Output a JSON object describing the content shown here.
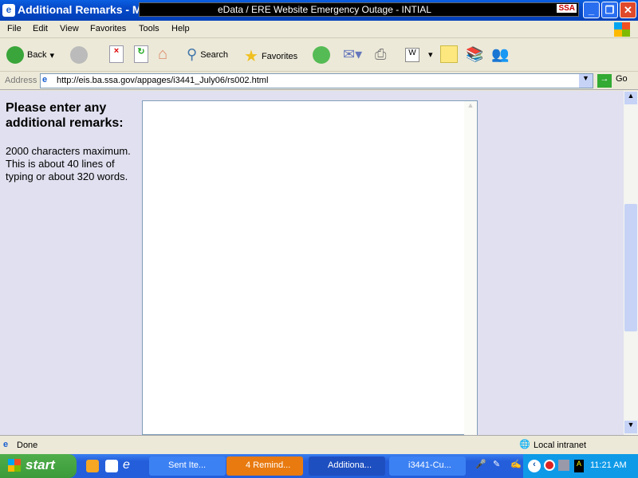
{
  "window": {
    "title": "Additional Remarks - Mic",
    "ticker": "eData / ERE Website Emergency Outage - INTIAL",
    "ticker_logo": "SSA"
  },
  "menu": [
    "File",
    "Edit",
    "View",
    "Favorites",
    "Tools",
    "Help"
  ],
  "toolbar": {
    "back": "Back",
    "search": "Search",
    "favorites": "Favorites"
  },
  "address": {
    "label": "Address",
    "url": "http://eis.ba.ssa.gov/appages/i3441_July06/rs002.html",
    "go": "Go"
  },
  "page": {
    "heading": "Please enter any additional remarks:",
    "note": "2000 characters maximum. This is about 40 lines of typing or about 320 words.",
    "textarea_value": ""
  },
  "status": {
    "text": "Done",
    "zone": "Local intranet"
  },
  "taskbar": {
    "start": "start",
    "tasks": [
      "Sent Ite...",
      "4 Remind...",
      "Additiona...",
      "i3441-Cu..."
    ],
    "clock": "11:21 AM"
  }
}
